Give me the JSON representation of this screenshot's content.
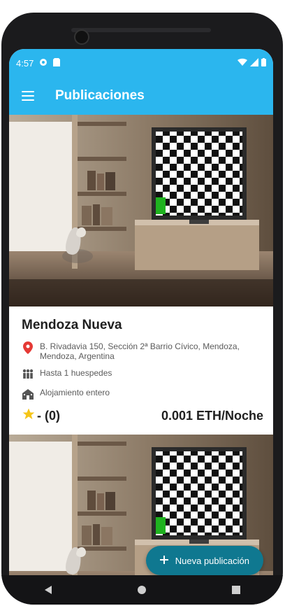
{
  "status_bar": {
    "time": "4:57"
  },
  "appbar": {
    "title": "Publicaciones"
  },
  "listing": {
    "title": "Mendoza Nueva",
    "address": "B. Rivadavia 150, Sección 2ª Barrio Cívico, Mendoza, Mendoza, Argentina",
    "guests": "Hasta 1 huespedes",
    "type": "Alojamiento entero",
    "rating": "- (0)",
    "price": "0.001 ETH/Noche"
  },
  "fab": {
    "label": "Nueva publicación"
  },
  "icons": {
    "menu": "menu-icon",
    "location": "location-icon",
    "guests": "people-icon",
    "property": "house-icon",
    "star": "star-icon",
    "add": "plus-icon"
  },
  "colors": {
    "primary": "#2bb6ee",
    "fab": "#0f7890",
    "star": "#f5c518",
    "location": "#e53935"
  }
}
